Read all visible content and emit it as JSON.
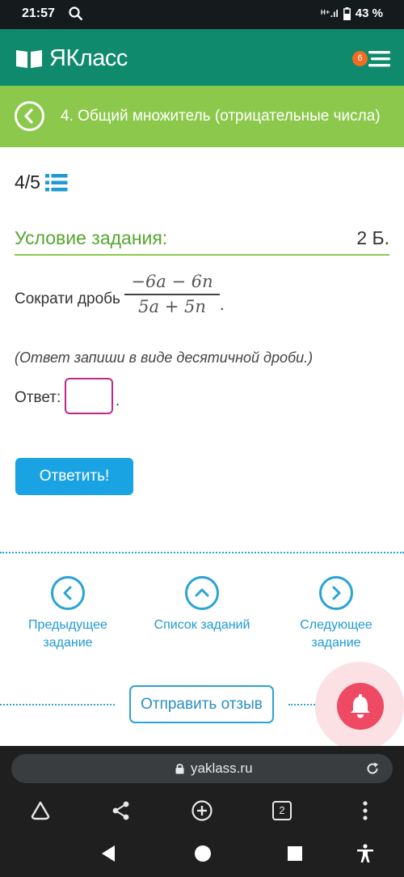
{
  "status_bar": {
    "time": "21:57",
    "signal": "ᴴ⁺.ıl",
    "battery": "43 %"
  },
  "header": {
    "logo_text": "ЯКласс",
    "notification_count": "6"
  },
  "topic": {
    "title": "4. Общий множитель (отрицательные числа)"
  },
  "progress": {
    "text": "4/5"
  },
  "condition": {
    "title": "Условие задания:",
    "points": "2 Б."
  },
  "task": {
    "text": "Сократи дробь",
    "numerator": "−6a − 6n",
    "denominator": "5a + 5n",
    "dot": "."
  },
  "hint": "(Ответ запиши в виде десятичной дроби.)",
  "answer": {
    "label": "Ответ:",
    "value": "",
    "dot": "."
  },
  "submit_label": "Ответить!",
  "nav": {
    "prev": {
      "line1": "Предыдущее",
      "line2": "задание"
    },
    "list": {
      "line1": "Список заданий"
    },
    "next": {
      "line1": "Следующее",
      "line2": "задание"
    }
  },
  "feedback_label": "Отправить отзыв",
  "browser": {
    "url": "yaklass.ru",
    "tabs_count": "2"
  },
  "colors": {
    "header_green": "#0f8a6c",
    "topic_green": "#8cc84b",
    "accent_blue": "#1aa3e3",
    "input_border": "#c12888",
    "bell_red": "#ef4a64"
  },
  "icons": [
    "search-icon",
    "book-logo-icon",
    "menu-icon",
    "back-arrow-icon",
    "list-icon",
    "chevron-left-icon",
    "chevron-up-icon",
    "chevron-right-icon",
    "bell-icon",
    "lock-icon",
    "reload-icon",
    "home-icon",
    "share-icon",
    "add-icon",
    "tabs-icon",
    "more-icon",
    "back-nav-icon",
    "home-nav-icon",
    "recents-nav-icon",
    "accessibility-icon"
  ]
}
